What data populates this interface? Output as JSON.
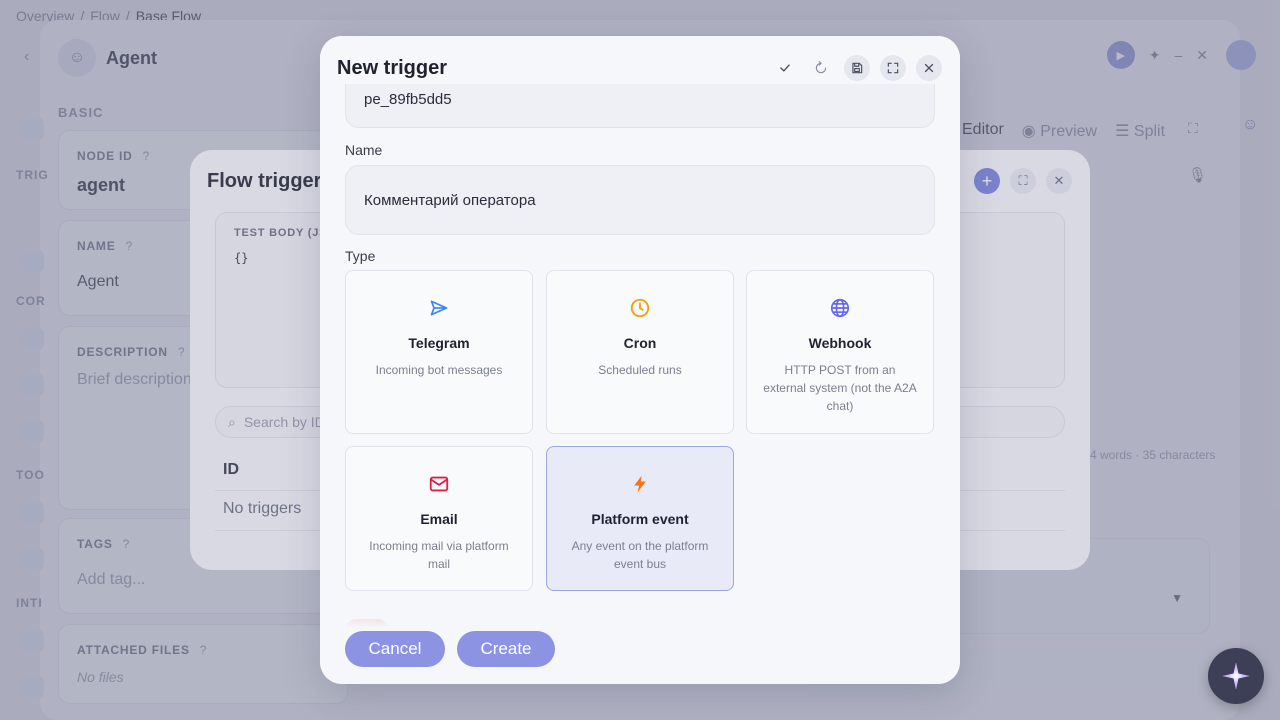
{
  "breadcrumb": {
    "items": [
      "Overview",
      "Flow"
    ],
    "current": "Base Flow",
    "sep": "/"
  },
  "agent": {
    "title": "Agent",
    "section_basic": "BASIC",
    "node_id": {
      "label": "NODE ID",
      "value": "agent"
    },
    "name": {
      "label": "NAME",
      "value": "Agent"
    },
    "description": {
      "label": "DESCRIPTION",
      "placeholder": "Brief description"
    },
    "tags": {
      "label": "TAGS",
      "placeholder": "Add tag..."
    },
    "attached_files": {
      "label": "ATTACHED FILES",
      "value": "No files"
    },
    "side_labels": [
      "TRIG",
      "COR",
      "TOO",
      "INTI"
    ],
    "help": "?"
  },
  "editor": {
    "tabs": [
      "Editor",
      "Preview",
      "Split"
    ],
    "word_count": "4 words · 35 characters"
  },
  "flow_triggers": {
    "title": "Flow triggers",
    "test_body_label": "TEST BODY (JS",
    "test_body_value": "{}",
    "search_placeholder": "Search by ID",
    "table_header_id": "ID",
    "empty": "No triggers"
  },
  "modal": {
    "title": "New trigger",
    "id_value": "pe_89fb5dd5",
    "name_label": "Name",
    "name_value": "Комментарий оператора",
    "type_label": "Type",
    "types": [
      {
        "name": "Telegram",
        "desc": "Incoming bot messages",
        "icon": "send-icon",
        "color": "#3b82f6"
      },
      {
        "name": "Cron",
        "desc": "Scheduled runs",
        "icon": "clock-icon",
        "color": "#f59e0b"
      },
      {
        "name": "Webhook",
        "desc": "HTTP POST from an external system (not the A2A chat)",
        "icon": "globe-icon",
        "color": "#6366f1"
      },
      {
        "name": "Email",
        "desc": "Incoming mail via platform mail",
        "icon": "mail-icon",
        "color": "#e11d48"
      },
      {
        "name": "Platform event",
        "desc": "Any event on the platform event bus",
        "icon": "bolt-icon",
        "color": "#f97316"
      }
    ],
    "selected_type": "Platform event",
    "cancel_label": "Cancel",
    "create_label": "Create"
  },
  "colors": {
    "accent": "#8c93e3",
    "selected_bg": "#e8eaf8"
  }
}
